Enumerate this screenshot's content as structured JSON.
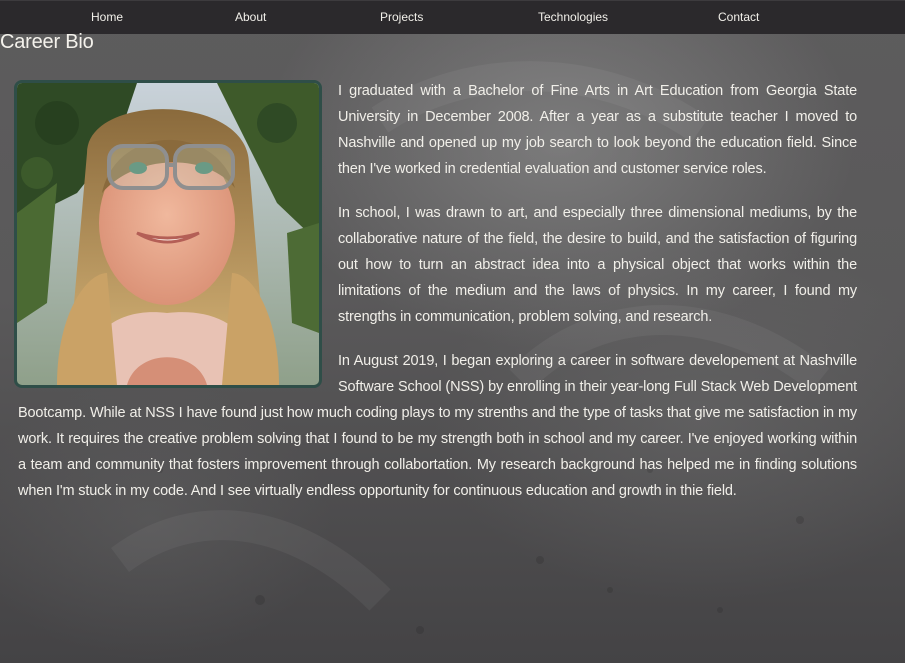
{
  "nav": {
    "items": [
      {
        "label": "Home"
      },
      {
        "label": "About"
      },
      {
        "label": "Projects"
      },
      {
        "label": "Technologies"
      },
      {
        "label": "Contact"
      }
    ]
  },
  "page": {
    "title": "Career Bio"
  },
  "bio": {
    "paragraphs": [
      "I graduated with a Bachelor of Fine Arts in Art Education from Georgia State University in December 2008. After a year as a substitute teacher I moved to Nashville and opened up my job search to look beyond the education field. Since then I've worked in credential evaluation and customer service roles.",
      "In school, I was drawn to art, and especially three dimensional mediums, by the collaborative nature of the field, the desire to build, and the satisfaction of figuring out how to turn an abstract idea into a physical object that works within the limitations of the medium and the laws of physics. In my career, I found my strengths in communication, problem solving, and research.",
      "In August 2019, I began exploring a career in software developement at Nashville Software School (NSS) by enrolling in their year-long Full Stack Web Development Bootcamp. While at NSS I have found just how much coding plays to my strenths and the type of tasks that give me satisfaction in my work. It requires the creative problem solving that I found to be my strength both in school and my career. I've enjoyed working within a team and community that fosters improvement through collabortation. My research background has helped me in finding solutions when I'm stuck in my code. And I see virtually endless opportunity for continuous education and growth in thie field."
    ]
  },
  "colors": {
    "nav_bg": "#2b292c",
    "photo_border": "#2f4e48",
    "text": "#f1efe9"
  }
}
